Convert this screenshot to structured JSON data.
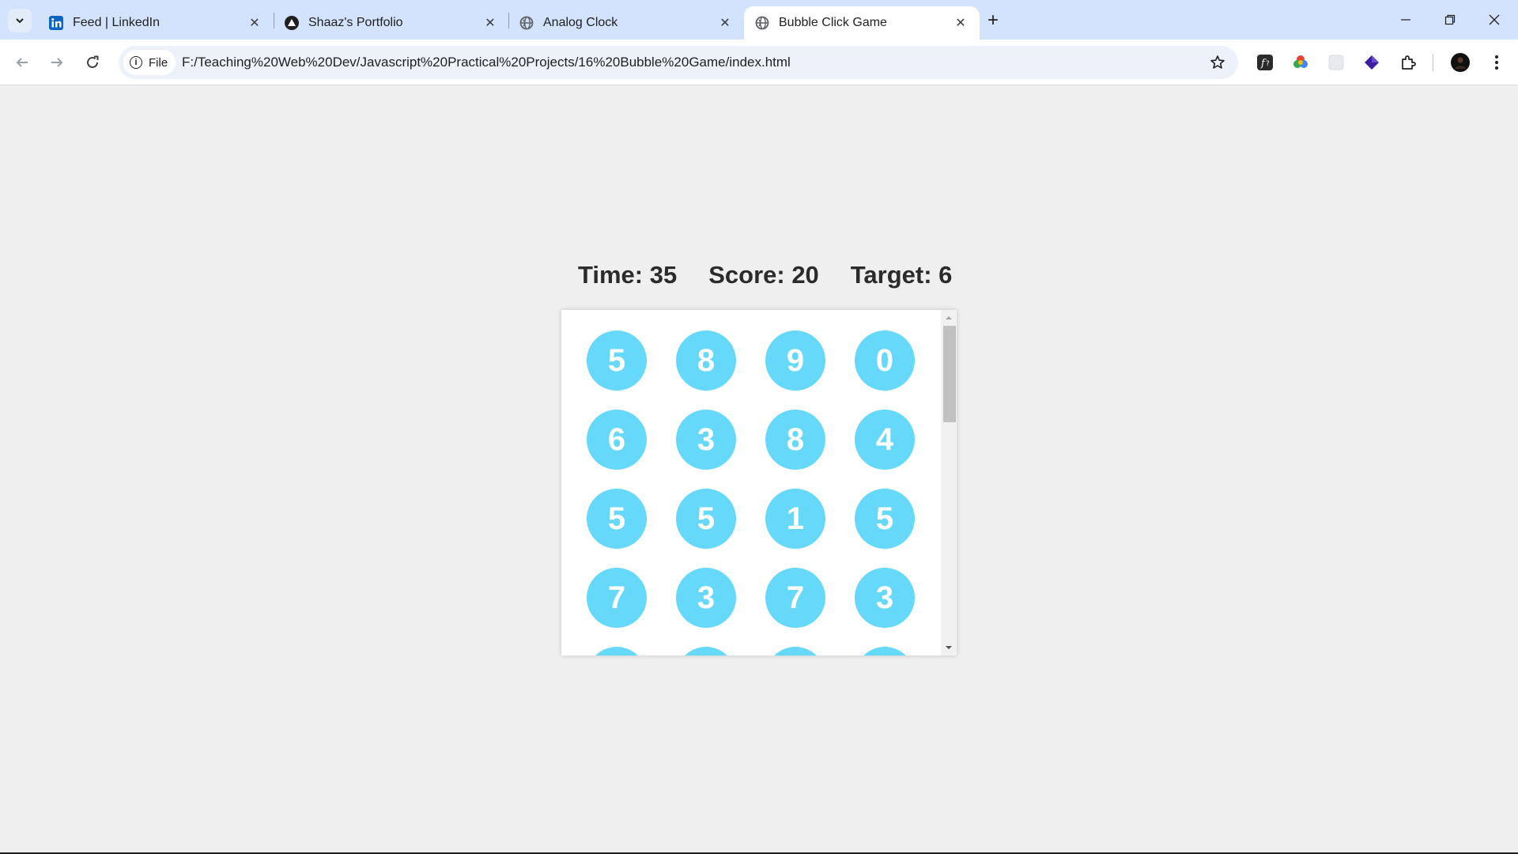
{
  "browser": {
    "tabs": [
      {
        "title": "Feed | LinkedIn",
        "favicon": "linkedin-icon",
        "active": false
      },
      {
        "title": "Shaaz's Portfolio",
        "favicon": "triangle-logo-icon",
        "active": false
      },
      {
        "title": "Analog Clock",
        "favicon": "globe-icon",
        "active": false
      },
      {
        "title": "Bubble Click Game",
        "favicon": "globe-icon",
        "active": true
      }
    ],
    "address_chip": "File",
    "url": "F:/Teaching%20Web%20Dev/Javascript%20Practical%20Projects/16%20Bubble%20Game/index.html",
    "extensions": [
      "font-extension-icon",
      "color-picker-extension-icon",
      "blank-extension-icon",
      "diamond-extension-icon",
      "puzzle-extensions-icon"
    ]
  },
  "game": {
    "time_text": "Time: 35",
    "score_text": "Score: 20",
    "target_text": "Target: 6",
    "bubble_color": "#66d8fa",
    "bubbles": [
      [
        "5",
        "8",
        "9",
        "0"
      ],
      [
        "6",
        "3",
        "8",
        "4"
      ],
      [
        "5",
        "5",
        "1",
        "5"
      ],
      [
        "7",
        "3",
        "7",
        "3"
      ],
      [
        "",
        "",
        "",
        ""
      ]
    ],
    "scroll_fraction": 0
  }
}
